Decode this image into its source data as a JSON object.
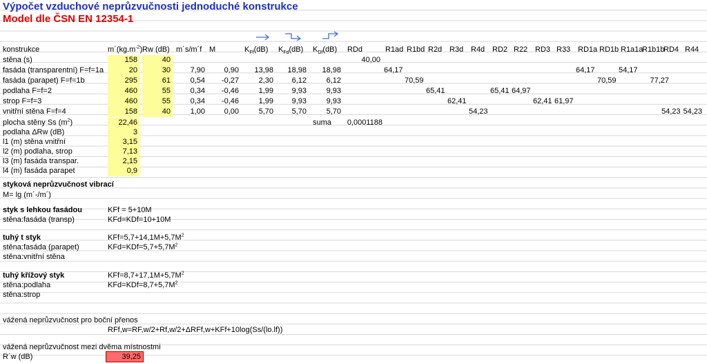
{
  "title": "Výpočet vzduchové neprůzvučnosti jednoduché konstrukce",
  "subtitle": "Model dle ČSN EN 12354-1",
  "headers": {
    "konstrukce": "konstrukce",
    "m": "m´(kg.m",
    "m_sup": "-2",
    "m_close": ")",
    "rw": "Rw (dB)",
    "msmf": "m´s/m´f",
    "M": "M",
    "kff": "K",
    "kff_sub": "Ff",
    "kfd": "K",
    "kfd_sub": "Fd",
    "kdf": "K",
    "kdf_sub": "Df",
    "db": "(dB)",
    "RDd": "RDd",
    "R1ad": "R1ad",
    "R1bd": "R1bd",
    "R2d": "R2d",
    "R3d": "R3d",
    "R4d": "R4d",
    "RD2": "RD2",
    "R22": "R22",
    "RD3": "RD3",
    "R33": "R33",
    "RD1a": "RD1a",
    "RD1b": "RD1b",
    "R1a1a": "R1a1a",
    "R1b1b": "R1b1b",
    "RD4": "RD4",
    "R44": "R44"
  },
  "rows": [
    {
      "label": "stěna (s)",
      "m": "158",
      "rw": "40",
      "RDd": "40,00"
    },
    {
      "label": "fasáda (transparentní) F=f=1a",
      "m": "20",
      "rw": "30",
      "msmf": "7,90",
      "M": "0,90",
      "kff": "13,98",
      "kfd": "18,98",
      "kdf": "18,98",
      "R1ad": "64,17",
      "RD1a": "64,17",
      "R1a1a": "54,17"
    },
    {
      "label": "fasáda (parapet) F=f=1b",
      "m": "295",
      "rw": "61",
      "msmf": "0,54",
      "M": "-0,27",
      "kff": "2,30",
      "kfd": "6,12",
      "kdf": "6,12",
      "R1bd": "70,59",
      "RD1b": "70,59",
      "R1b1b": "77,27"
    },
    {
      "label": "podlaha F=f=2",
      "m": "460",
      "rw": "55",
      "msmf": "0,34",
      "M": "-0,46",
      "kff": "1,99",
      "kfd": "9,93",
      "kdf": "9,93",
      "R2d": "65,41",
      "RD2": "65,41",
      "R22": "64,97"
    },
    {
      "label": "strop F=f=3",
      "m": "460",
      "rw": "55",
      "msmf": "0,34",
      "M": "-0,46",
      "kff": "1,99",
      "kfd": "9,93",
      "kdf": "9,93",
      "R3d": "62,41",
      "RD3": "62,41",
      "R33": "61,97"
    },
    {
      "label": "vnitřní stěna F=f=4",
      "m": "158",
      "rw": "40",
      "msmf": "1,00",
      "M": "0,00",
      "kff": "5,70",
      "kfd": "5,70",
      "kdf": "5,70",
      "R4d": "54,23",
      "RD4": "54,23",
      "R44": "54,23"
    }
  ],
  "params": [
    {
      "label": "plocha stěny Ss (m",
      "sup": "2",
      "close": ")",
      "value": "22,46"
    },
    {
      "label": "podlaha  ΔRw (dB)",
      "value": "3"
    },
    {
      "label": "l1 (m) stěna vnitřní",
      "value": "3,15"
    },
    {
      "label": "l2 (m) podlaha, strop",
      "value": "7,13"
    },
    {
      "label": "l3 (m) fasáda transpar.",
      "value": "2,15"
    },
    {
      "label": "l4 (m) fasáda parapet",
      "value": "0,9"
    }
  ],
  "suma_label": "suma",
  "suma_value": "0,0001188",
  "vibration": {
    "heading": "styková neprůzvučnost vibrací",
    "formula": "M= lg (m´-/m´)"
  },
  "joints": [
    {
      "heading": "styk s lehkou fasádou",
      "formula1": "KFf = 5+10M",
      "sub1": "stěna:fasáda (transp)",
      "formula2": "KFd=KDf=10+10M"
    },
    {
      "heading": "tuhý t styk",
      "formula1": "KFf=5,7+14,1M+5,7M",
      "sup1": "2",
      "sub1": "stěna:fasáda (parapet)",
      "formula2": "KFd=KDf=5,7+5,7M",
      "sup2": "2",
      "sub2": "stěna:vnitřní stěna"
    },
    {
      "heading": "tuhý křížový styk",
      "formula1": "KFf=8,7+17,1M+5,7M",
      "sup1": "2",
      "sub1": "stěna:podlaha",
      "formula2": "KFd=KDf=8,7+5,7M",
      "sup2": "2",
      "sub2": "stěna:strop"
    }
  ],
  "flank": {
    "label": "vážená neprůzvučnost pro boční přenos",
    "formula": "RFf,w=RF,w/2+Rf,w/2+ΔRFf,w+KFf+10log(Ss/(lo.lf))"
  },
  "result": {
    "label": "vážená neprůzvučnost mezi dvěma místnostmi",
    "name": "R´w (dB)",
    "value": "39,25"
  },
  "colors": {
    "title": "#1f2ec8",
    "subtitle": "#e00000",
    "highlight": "#fdfd99",
    "result": "#ff6b6b",
    "arrow": "#3a6fd8"
  }
}
